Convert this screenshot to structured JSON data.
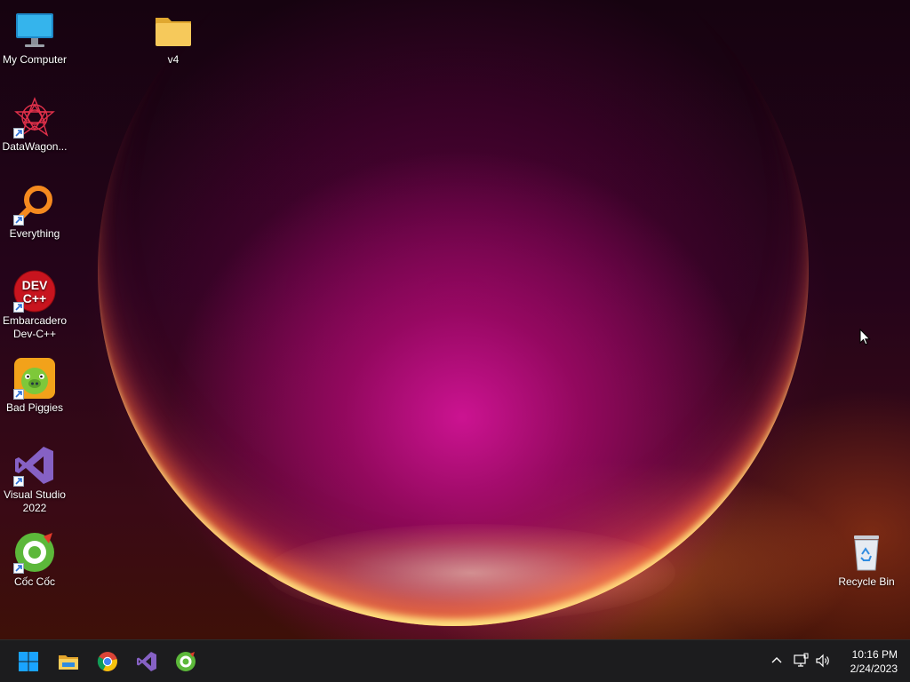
{
  "desktop": {
    "icons": [
      {
        "label": "My Computer",
        "icon": "monitor-icon"
      },
      {
        "label": "v4",
        "icon": "folder-icon"
      },
      {
        "label": "DataWagon...",
        "icon": "datawagon-icon"
      },
      {
        "label": "Everything",
        "icon": "everything-search-icon"
      },
      {
        "label": "Embarcadero Dev-C++",
        "icon": "devcpp-icon",
        "badge": "DEV C++"
      },
      {
        "label": "Bad Piggies",
        "icon": "bad-piggies-icon"
      },
      {
        "label": "Visual Studio 2022",
        "icon": "visual-studio-icon"
      },
      {
        "label": "Cốc Cốc",
        "icon": "coccoc-icon"
      },
      {
        "label": "Recycle Bin",
        "icon": "recycle-bin-icon"
      }
    ]
  },
  "taskbar": {
    "pinned": [
      {
        "name": "Start",
        "icon": "windows-start-icon"
      },
      {
        "name": "File Explorer",
        "icon": "file-explorer-icon"
      },
      {
        "name": "Google Chrome",
        "icon": "chrome-icon"
      },
      {
        "name": "Visual Studio",
        "icon": "visual-studio-icon"
      },
      {
        "name": "Cốc Cốc",
        "icon": "coccoc-icon"
      }
    ],
    "tray": {
      "chevron_icon": "chevron-up-icon",
      "network_icon": "network-icon",
      "volume_icon": "volume-icon",
      "time": "10:16 PM",
      "date": "2/24/2023"
    }
  },
  "colors": {
    "taskbar_bg": "#1c1c1e",
    "windows_blue": "#1aa3ff",
    "folder_yellow": "#f6c95b",
    "vs_purple": "#8661c5"
  }
}
